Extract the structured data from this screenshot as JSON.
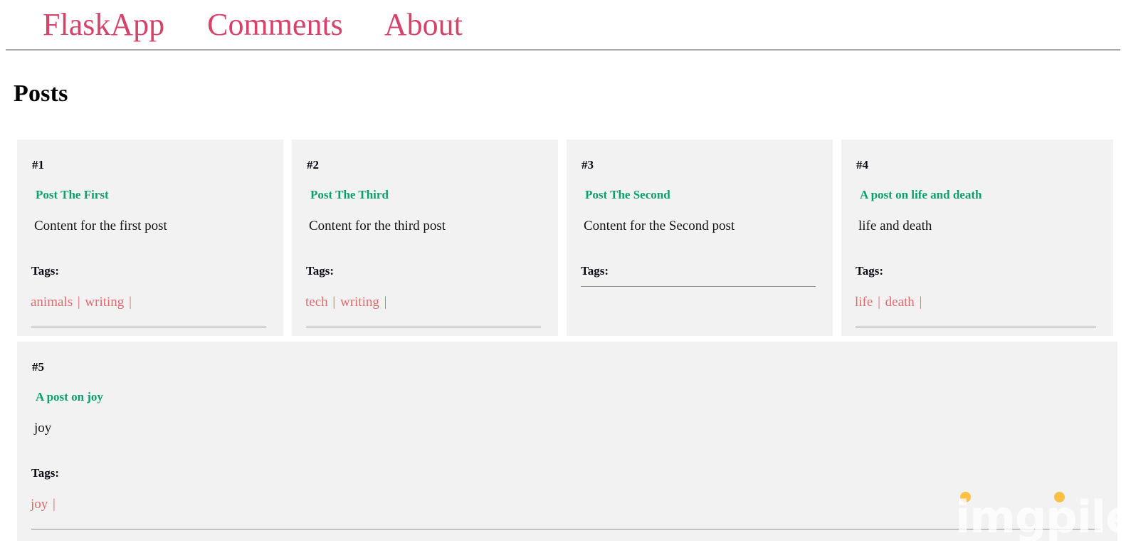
{
  "nav": {
    "brand": "FlaskApp",
    "items": [
      {
        "label": "Comments"
      },
      {
        "label": "About"
      }
    ]
  },
  "page": {
    "title": "Posts",
    "tags_label": "Tags:",
    "tag_separator": "|"
  },
  "posts": [
    {
      "id": "#1",
      "title": "Post The First",
      "content": "Content for the first post",
      "tags": [
        "animals",
        "writing"
      ]
    },
    {
      "id": "#2",
      "title": "Post The Third",
      "content": "Content for the third post",
      "tags": [
        "tech",
        "writing"
      ]
    },
    {
      "id": "#3",
      "title": "Post The Second",
      "content": "Content for the Second post",
      "tags": []
    },
    {
      "id": "#4",
      "title": "A post on life and death",
      "content": "life and death",
      "tags": [
        "life",
        "death"
      ]
    },
    {
      "id": "#5",
      "title": "A post on joy",
      "content": "joy",
      "tags": [
        "joy"
      ]
    }
  ],
  "watermark": {
    "text": "imgpile",
    "dot_color": "#fcc045"
  },
  "colors": {
    "nav_link": "#d6436a",
    "post_title": "#0aa06c",
    "tag_link": "#e2696d",
    "card_background": "#f2f2f2",
    "rule": "#8c8c8c"
  }
}
